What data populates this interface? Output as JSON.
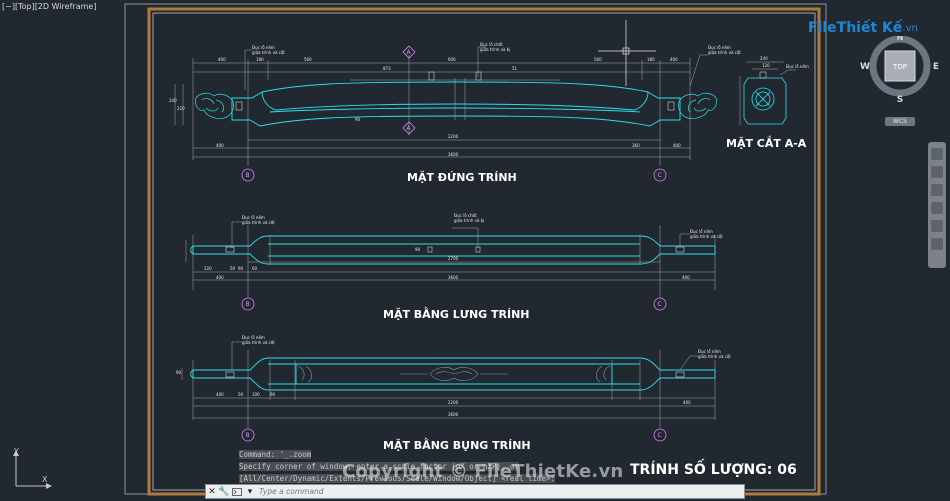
{
  "viewport": {
    "label": "[−][Top][2D Wireframe]"
  },
  "drawing": {
    "views": [
      {
        "title": "MẶT ĐỨNG TRÍNH"
      },
      {
        "title": "MẶT BẰNG LƯNG TRÍNH"
      },
      {
        "title": "MẶT BẰNG BỤNG TRÍNH"
      }
    ],
    "section_title": "MẶT CẮT A-A",
    "quantity_note": "TRÍNH SỐ LƯỢNG: 06",
    "section_marks": [
      "A",
      "A"
    ],
    "grid_bubbles": [
      "B",
      "C"
    ],
    "notes": {
      "mortise_pin": "Đục lỗ nêm",
      "mortise_pin_sub": "giữa trình và cột",
      "mortise_post": "Đục lỗ chốt",
      "mortise_post_sub": "giữa trình và bị"
    },
    "dims": {
      "total": "3600",
      "inner": "2200",
      "span": "2700",
      "end": "400",
      "small": "180",
      "d950": "950",
      "d560": "560",
      "d873": "873",
      "d600": "600",
      "d51": "51",
      "d90": "90",
      "d120": "120",
      "d240": "240",
      "d220": "220",
      "d280": "280",
      "d360": "360",
      "d200": "200",
      "d100": "100",
      "d60": "60",
      "d50": "50"
    }
  },
  "logo": {
    "part1": "File",
    "part2": "Thiết Kế",
    "part3": ".vn"
  },
  "viewcube": {
    "top": "TOP",
    "n": "N",
    "s": "S",
    "e": "E",
    "w": "W",
    "wcs": "WCS"
  },
  "command": {
    "history": [
      "Command: '_.zoom",
      "Specify corner of window, enter a scale factor (nX or nXP), or",
      "[All/Center/Dynamic/Extents/Previous/Scale/Window/Object] <real time>:"
    ],
    "placeholder": "Type a command"
  },
  "watermark": "Copyright © FileThietKe.vn",
  "ucs": {
    "x": "X",
    "y": "Y"
  },
  "colors": {
    "background": "#212830",
    "frame_outer": "#b07a3a",
    "frame_inner": "#c98a45",
    "outline": "#29e0e8",
    "dimension": "#c8c8c8",
    "bubble": "#e080ff",
    "text": "#ffffff"
  }
}
